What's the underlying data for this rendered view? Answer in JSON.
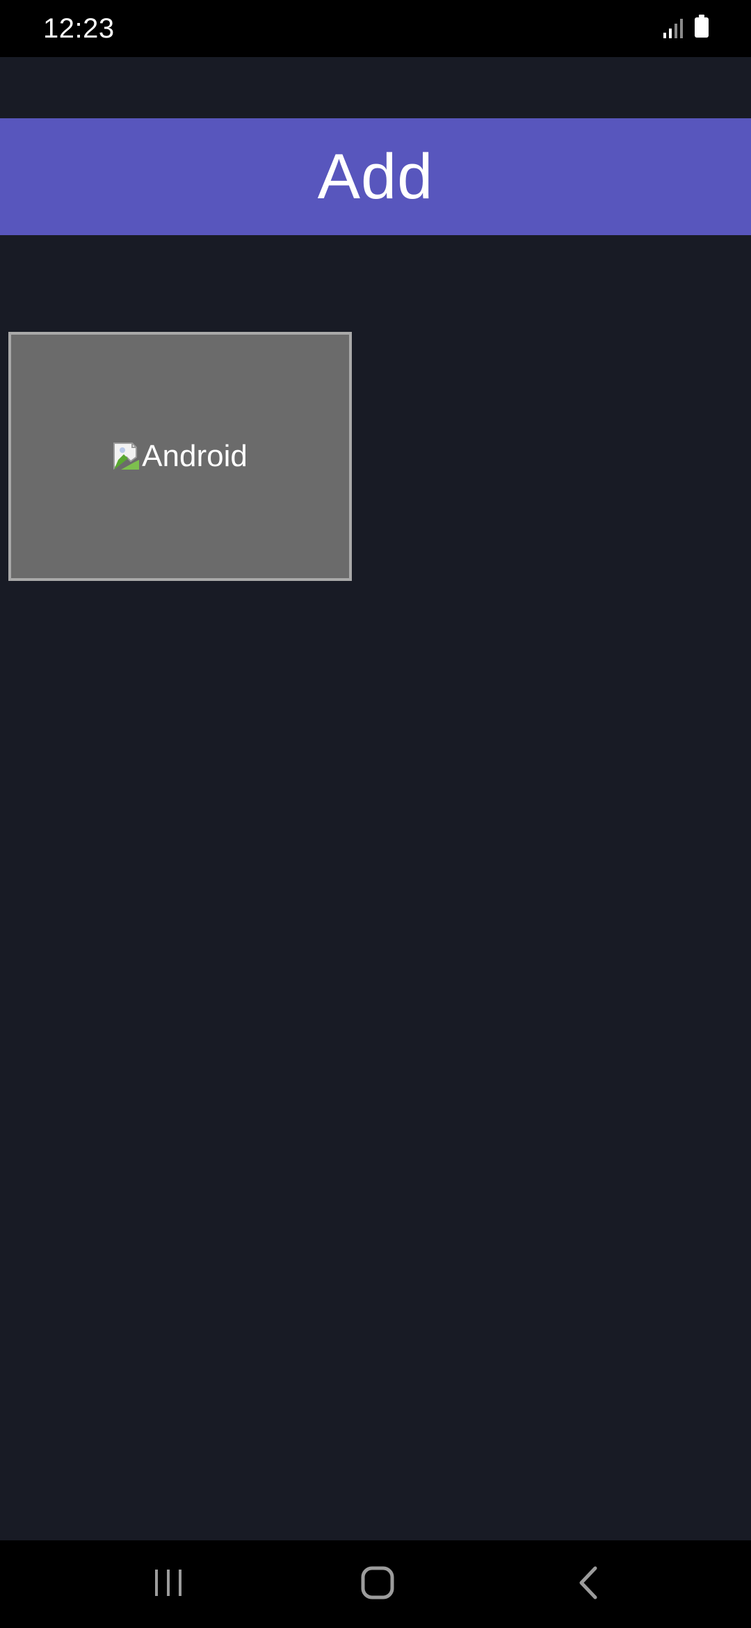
{
  "status_bar": {
    "time": "12:23",
    "icons": [
      "signal-icon",
      "battery-icon"
    ]
  },
  "header": {
    "title": "Add"
  },
  "tile": {
    "icon": "broken-image-icon",
    "label": "Android"
  },
  "nav_bar": {
    "icons": [
      "recent-apps-icon",
      "home-icon",
      "back-icon"
    ]
  },
  "colors": {
    "background": "#181b25",
    "header": "#5856bd",
    "tile_fill": "#6b6b6b",
    "tile_border": "#a9a9a9",
    "system_bars": "#000000"
  }
}
